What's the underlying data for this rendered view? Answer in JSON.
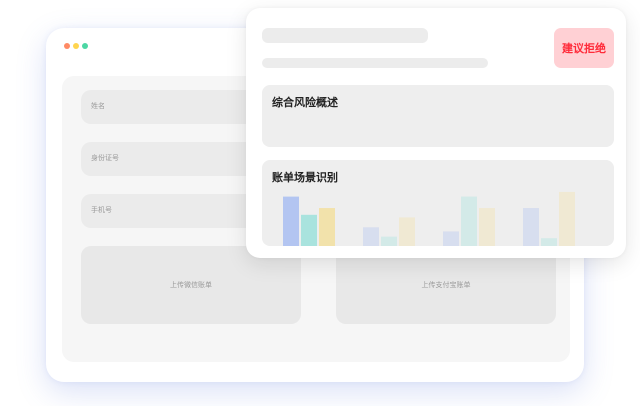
{
  "form": {
    "name_label": "姓名",
    "id_label": "身份证号",
    "phone_label": "手机号",
    "upload_wechat_label": "上传微信账单",
    "upload_alipay_label": "上传支付宝账单"
  },
  "report": {
    "recommendation": "建议拒绝",
    "risk_overview_title": "综合风险概述",
    "scenario_title": "账单场景识别"
  },
  "colors": {
    "accent_red": "#ff2b3a",
    "badge_bg": "#ffd0d4",
    "bar_blue": "#b3c5f1",
    "bar_teal": "#a9e3de",
    "bar_yellow": "#f2e2ab"
  },
  "chart_data": {
    "type": "bar",
    "title": "",
    "xlabel": "",
    "ylabel": "",
    "grid": false,
    "legend": "none",
    "categories": [
      "",
      "",
      "",
      ""
    ],
    "ylim": [
      0,
      10
    ],
    "series": [
      {
        "values": [
          9.5,
          3.6,
          2.8,
          7.3
        ]
      },
      {
        "values": [
          6.0,
          1.8,
          9.5,
          1.5
        ]
      },
      {
        "values": [
          7.3,
          5.5,
          7.3,
          10.4
        ]
      }
    ],
    "series_colors": [
      "#b3c5f1",
      "#a9e3de",
      "#f2e2ab"
    ],
    "series_opacity": [
      [
        1.0,
        0.4,
        0.4,
        0.4
      ],
      [
        1.0,
        0.4,
        0.4,
        0.4
      ],
      [
        1.0,
        0.4,
        0.4,
        0.4
      ]
    ]
  }
}
